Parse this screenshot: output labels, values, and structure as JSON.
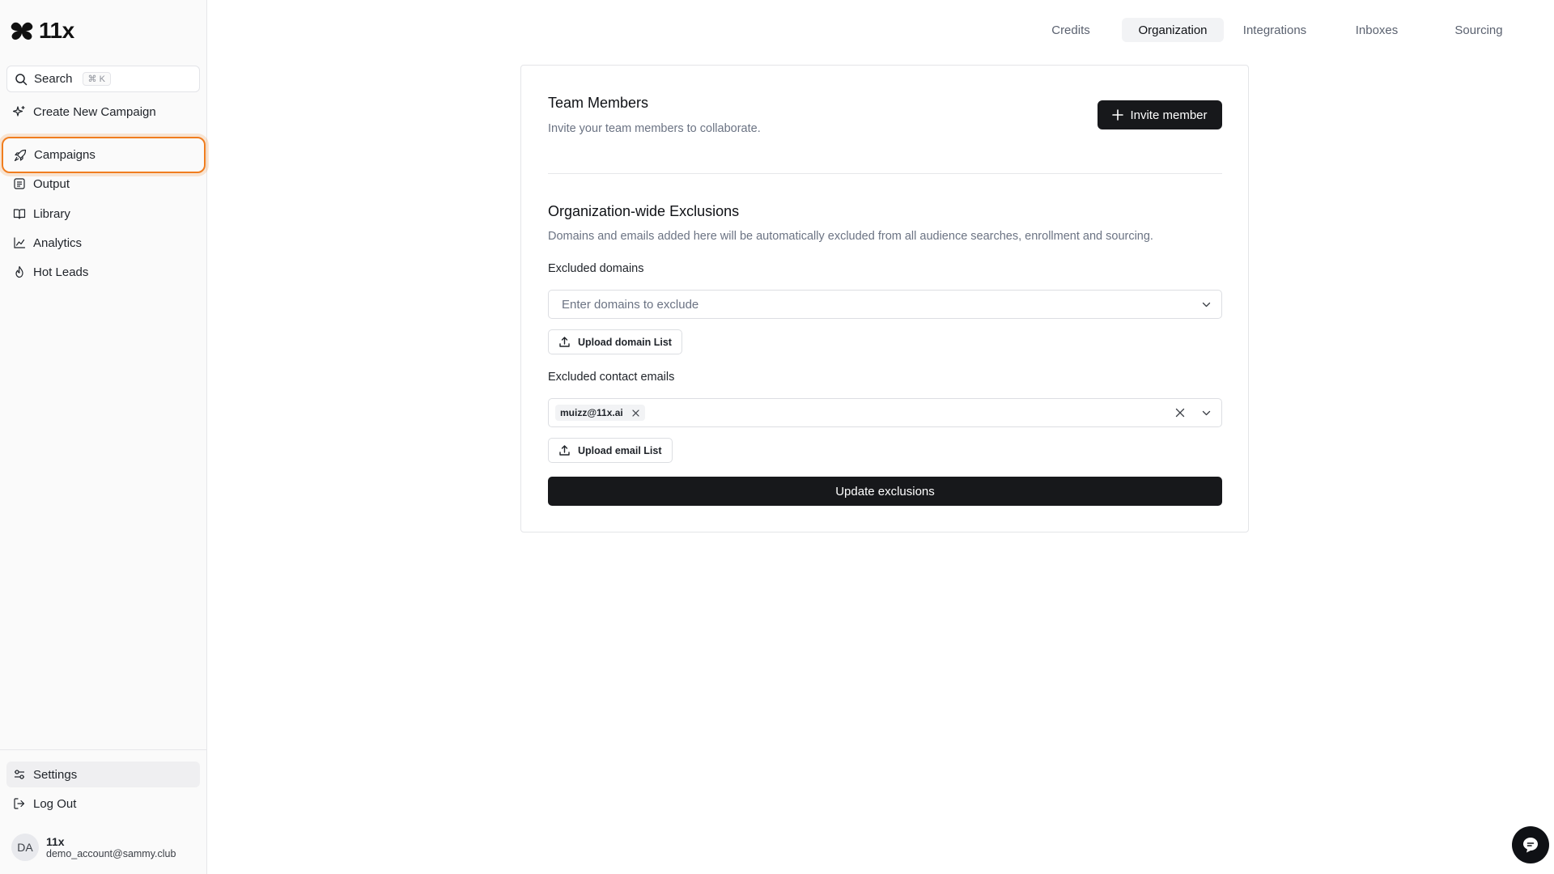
{
  "brand": {
    "name": "11x"
  },
  "sidebar": {
    "search": {
      "label": "Search",
      "shortcut": "⌘ K"
    },
    "items": [
      {
        "label": "Create New Campaign",
        "icon": "sparkles-icon"
      },
      {
        "label": "Campaigns",
        "icon": "rocket-icon",
        "highlighted": true
      },
      {
        "label": "Output",
        "icon": "output-icon"
      },
      {
        "label": "Library",
        "icon": "book-icon"
      },
      {
        "label": "Analytics",
        "icon": "chart-line-icon"
      },
      {
        "label": "Hot Leads",
        "icon": "flame-icon"
      }
    ],
    "bottom": [
      {
        "label": "Settings",
        "icon": "settings-sliders-icon",
        "active": true
      },
      {
        "label": "Log Out",
        "icon": "logout-icon"
      }
    ],
    "user": {
      "initials": "DA",
      "name": "11x",
      "email": "demo_account@sammy.club"
    }
  },
  "tabs": [
    {
      "label": "Credits",
      "active": false
    },
    {
      "label": "Organization",
      "active": true
    },
    {
      "label": "Integrations",
      "active": false
    },
    {
      "label": "Inboxes",
      "active": false
    },
    {
      "label": "Sourcing",
      "active": false
    }
  ],
  "team": {
    "title": "Team Members",
    "subtitle": "Invite your team members to collaborate.",
    "invite_label": "Invite member"
  },
  "exclusions": {
    "title": "Organization-wide Exclusions",
    "subtitle": "Domains and emails added here will be automatically excluded from all audience searches, enrollment and sourcing.",
    "domains_label": "Excluded domains",
    "domains_placeholder": "Enter domains to exclude",
    "upload_domain_label": "Upload domain List",
    "emails_label": "Excluded contact emails",
    "emails": [
      "muizz@11x.ai"
    ],
    "upload_email_label": "Upload email List",
    "update_label": "Update exclusions"
  },
  "colors": {
    "highlight": "#f07d1e",
    "primary_button": "#17181b"
  }
}
